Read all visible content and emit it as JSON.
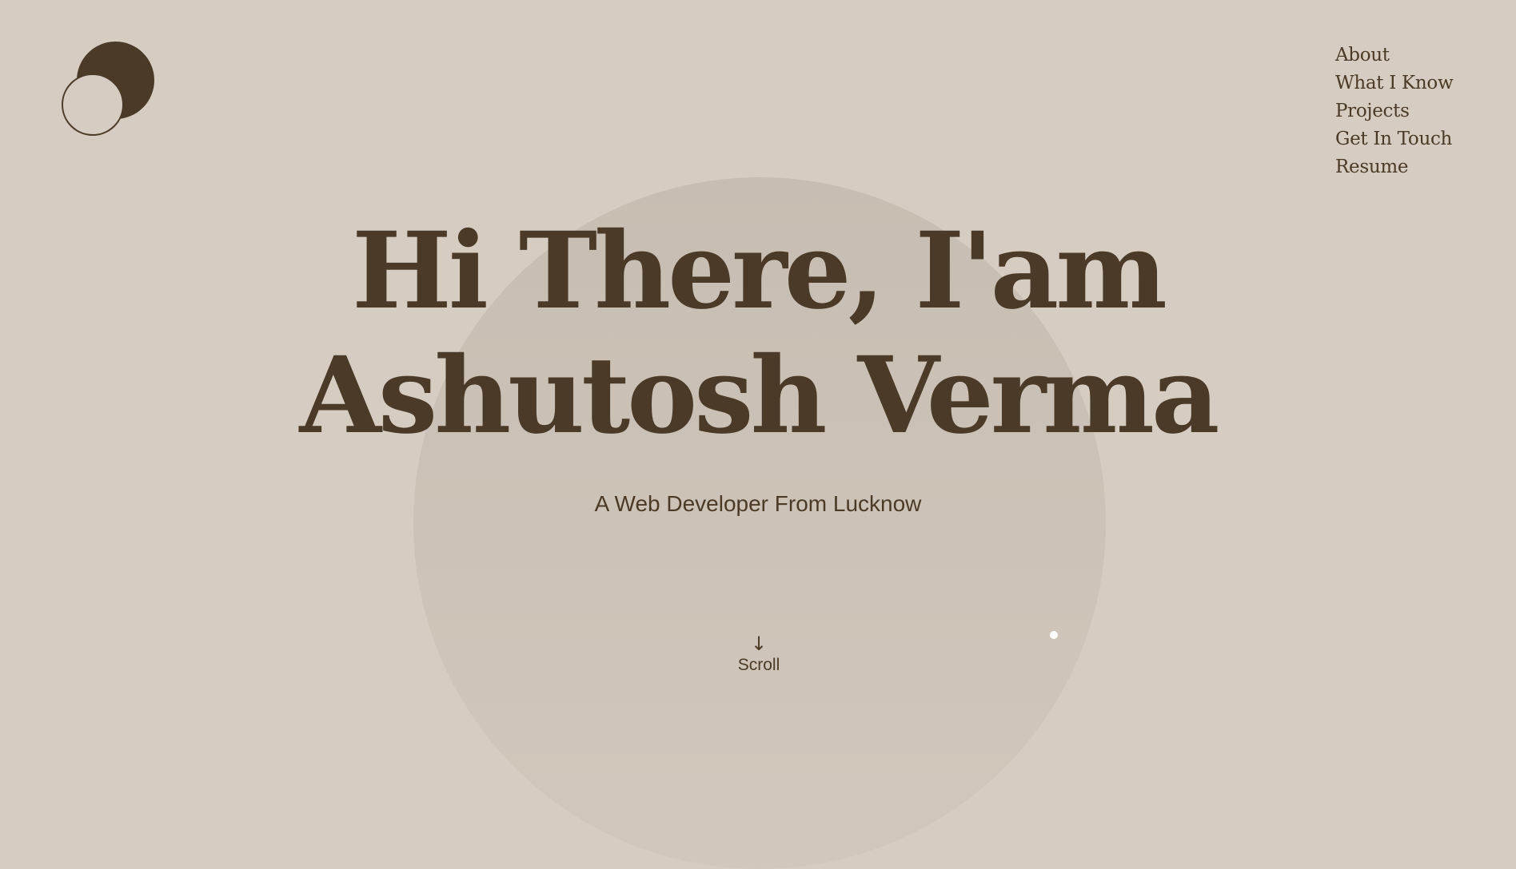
{
  "nav": {
    "items": [
      {
        "label": "About"
      },
      {
        "label": "What I Know"
      },
      {
        "label": "Projects"
      },
      {
        "label": "Get In Touch"
      },
      {
        "label": "Resume"
      }
    ]
  },
  "hero": {
    "line1": "Hi There, I'am",
    "line2": "Ashutosh Verma",
    "subtitle": "A Web Developer From Lucknow"
  },
  "scroll": {
    "icon": "arrow-down-icon",
    "label": "Scroll"
  },
  "colors": {
    "background": "#d6ccc2",
    "circle": "#c8bdb2",
    "text": "#4b3a28",
    "dot": "#ffffff"
  }
}
